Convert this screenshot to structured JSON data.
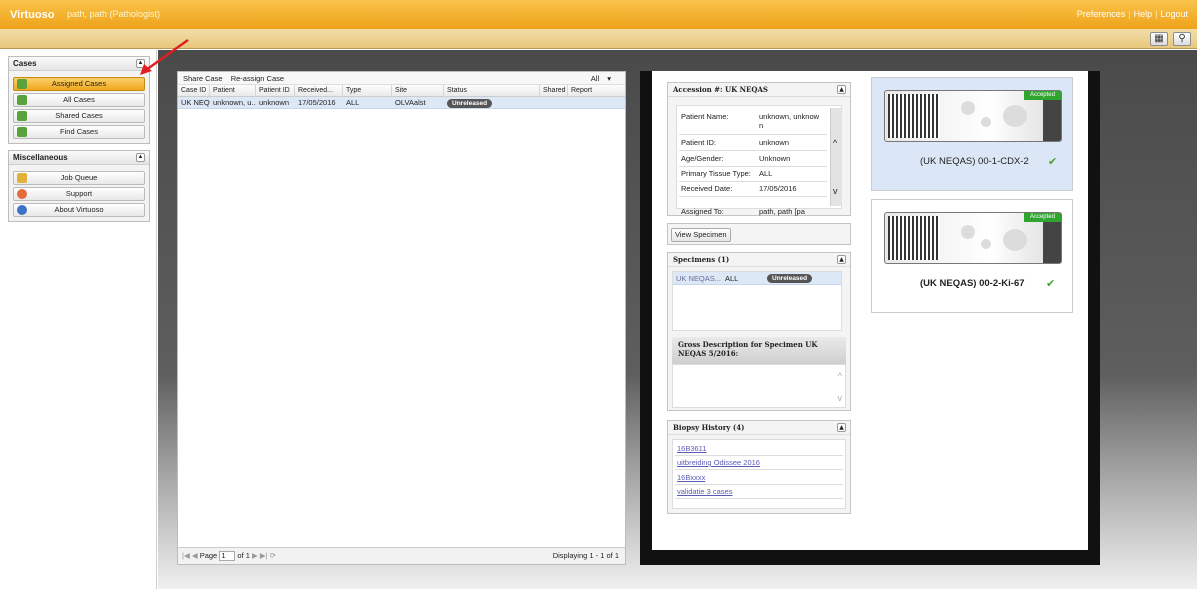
{
  "topbar": {
    "brand": "Virtuoso",
    "user": "path, path (Pathologist)",
    "links": [
      "Preferences",
      "Help",
      "Logout"
    ]
  },
  "sidebar": {
    "cases_title": "Cases",
    "cases_items": [
      "Assigned Cases",
      "All Cases",
      "Shared Cases",
      "Find Cases"
    ],
    "misc_title": "Miscellaneous",
    "misc_items": [
      "Job Queue",
      "Support",
      "About Virtuoso"
    ]
  },
  "grid": {
    "toolbar": {
      "share": "Share Case",
      "reassign": "Re-assign Case",
      "filter": "All"
    },
    "columns": [
      "Case ID",
      "Patient",
      "Patient ID",
      "Received...",
      "Type",
      "Site",
      "Status",
      "Shared",
      "Report"
    ],
    "rows": [
      {
        "case_id": "UK NEQAS",
        "patient": "unknown, u...",
        "patient_id": "unknown",
        "received": "17/05/2016",
        "type": "ALL",
        "site": "OLVAalst",
        "status": "Unreleased",
        "shared": "",
        "report": ""
      }
    ],
    "pager": {
      "page_label": "Page",
      "page": "1",
      "of": "of 1",
      "displaying": "Displaying 1 - 1 of 1"
    }
  },
  "accession": {
    "title": "Accession #: UK NEQAS",
    "fields": [
      {
        "label": "Patient Name:",
        "value": "unknown, unknow n"
      },
      {
        "label": "Patient ID:",
        "value": "unknown"
      },
      {
        "label": "Age/Gender:",
        "value": "Unknown"
      },
      {
        "label": "Primary Tissue Type:",
        "value": "ALL"
      },
      {
        "label": "Received Date:",
        "value": "17/05/2016"
      },
      {
        "label": "Assigned To:",
        "value": "path, path [pa"
      }
    ],
    "view_specimen": "View Specimen"
  },
  "specimens": {
    "title": "Specimens (1)",
    "row": {
      "name": "UK NEQAS...",
      "type": "ALL",
      "status": "Unreleased"
    },
    "gross_title": "Gross Description for Specimen UK NEQAS 5/2016:"
  },
  "biopsy": {
    "title": "Biopsy History (4)",
    "items": [
      "16B3611",
      "uitbreiding Odissee 2016",
      "16Bxxxx",
      "validatie 3 cases"
    ]
  },
  "slides": [
    {
      "title": "(UK NEQAS) 00-1-CDX-2",
      "badge": "Accepted"
    },
    {
      "title": "(UK NEQAS) 00-2-Ki-67",
      "badge": "Accepted"
    }
  ],
  "colors": {
    "accent": "#f0a71f",
    "accepted": "#2fa52f"
  }
}
